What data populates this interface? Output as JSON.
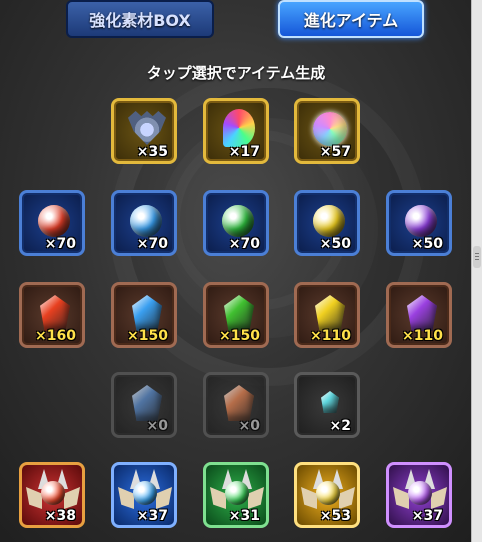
{
  "tabs": [
    {
      "label": "強化素材BOX",
      "active": false
    },
    {
      "label": "進化アイテム",
      "active": true
    }
  ],
  "subtitle": "タップ選択でアイテム生成",
  "rows": [
    {
      "frame": "gold",
      "items": [
        {
          "icon": "crest-icon",
          "qty": "×35"
        },
        {
          "icon": "rainbow-swirl-icon",
          "qty": "×17"
        },
        {
          "icon": "rainbow-orb-icon",
          "qty": "×57"
        }
      ]
    },
    {
      "frame": "blue",
      "items": [
        {
          "icon": "fire-orb-icon",
          "color": "#e8402a",
          "qty": "×70"
        },
        {
          "icon": "water-orb-icon",
          "color": "#3aa0f0",
          "qty": "×70"
        },
        {
          "icon": "wood-orb-icon",
          "color": "#30c040",
          "qty": "×70"
        },
        {
          "icon": "light-orb-icon",
          "color": "#f0d020",
          "qty": "×50"
        },
        {
          "icon": "dark-orb-icon",
          "color": "#9040e0",
          "qty": "×50"
        }
      ]
    },
    {
      "frame": "brown",
      "items": [
        {
          "icon": "fire-stone-icon",
          "color": "#e84020",
          "qty": "×160"
        },
        {
          "icon": "water-stone-icon",
          "color": "#3a9ff0",
          "qty": "×150"
        },
        {
          "icon": "wood-stone-icon",
          "color": "#40c030",
          "qty": "×150"
        },
        {
          "icon": "light-stone-icon",
          "color": "#f0d020",
          "qty": "×110"
        },
        {
          "icon": "dark-stone-icon",
          "color": "#9a40e0",
          "qty": "×110"
        }
      ]
    },
    {
      "frame": "gray",
      "items": [
        {
          "icon": "water-crystal-icon",
          "color": "#5a8ac8",
          "qty": "×0"
        },
        {
          "icon": "fire-crystal-icon",
          "color": "#e08050",
          "qty": "×0"
        },
        {
          "icon": "small-crystal-icon",
          "color": "#60d8e0",
          "qty": "×2"
        }
      ]
    },
    {
      "frame": "element",
      "items": [
        {
          "icon": "fire-monster-icon",
          "element": "fire",
          "color": "#ff5030",
          "qty": "×38"
        },
        {
          "icon": "water-monster-icon",
          "element": "water",
          "color": "#40b0ff",
          "qty": "×37"
        },
        {
          "icon": "wood-monster-icon",
          "element": "wood",
          "color": "#40e060",
          "qty": "×31"
        },
        {
          "icon": "light-monster-icon",
          "element": "light",
          "color": "#ffe040",
          "qty": "×53"
        },
        {
          "icon": "dark-monster-icon",
          "element": "dark",
          "color": "#c060ff",
          "qty": "×37"
        }
      ]
    }
  ]
}
